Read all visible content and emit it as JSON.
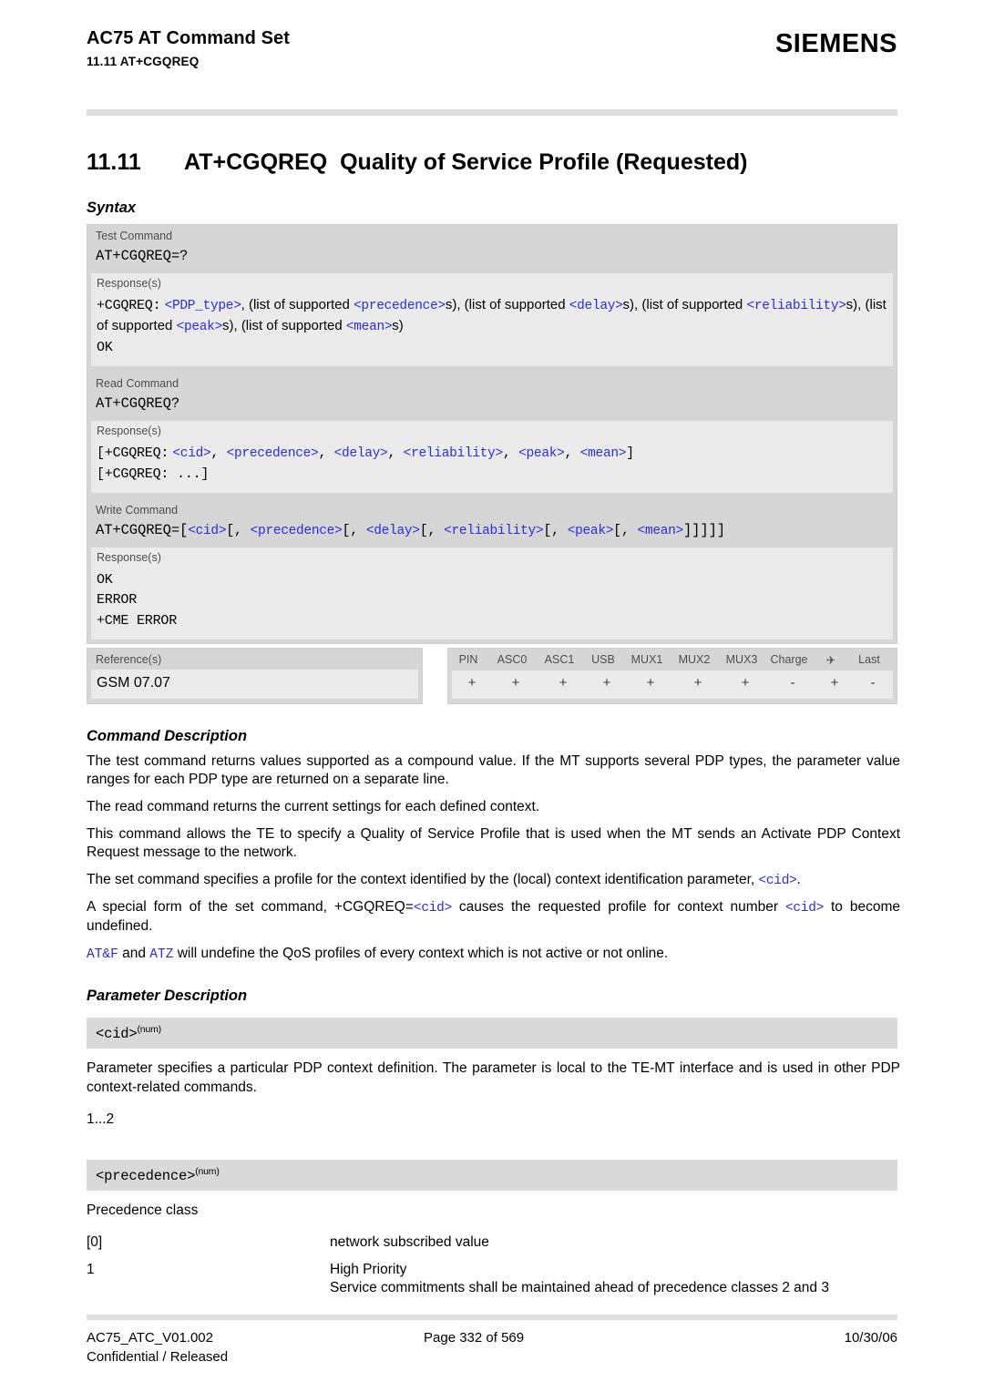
{
  "header": {
    "doc_title": "AC75 AT Command Set",
    "section_ref": "11.11 AT+CGQREQ",
    "brand": "SIEMENS"
  },
  "chapter": {
    "number": "11.11",
    "command": "AT+CGQREQ",
    "title": "Quality of Service Profile (Requested)"
  },
  "sections": {
    "syntax": "Syntax",
    "command_description": "Command Description",
    "parameter_description": "Parameter Description"
  },
  "syntax": {
    "test": {
      "label": "Test Command",
      "command": "AT+CGQREQ=?",
      "response_label": "Response(s)",
      "response_prefix": "+CGQREQ:",
      "response_parts": [
        {
          "t": "param",
          "v": "<PDP_type>"
        },
        {
          "t": "text",
          "v": ", (list of supported "
        },
        {
          "t": "param",
          "v": "<precedence>"
        },
        {
          "t": "text",
          "v": "s), (list of supported "
        },
        {
          "t": "param",
          "v": "<delay>"
        },
        {
          "t": "text",
          "v": "s), (list of supported "
        },
        {
          "t": "param",
          "v": "<reliability>"
        },
        {
          "t": "text",
          "v": "s), (list of supported "
        },
        {
          "t": "param",
          "v": "<peak>"
        },
        {
          "t": "text",
          "v": "s), (list of supported "
        },
        {
          "t": "param",
          "v": "<mean>"
        },
        {
          "t": "text",
          "v": "s)"
        }
      ],
      "ok": "OK"
    },
    "read": {
      "label": "Read Command",
      "command": "AT+CGQREQ?",
      "response_label": "Response(s)",
      "line1_prefix": "[+CGQREQ:",
      "line1_params": [
        "<cid>",
        "<precedence>",
        "<delay>",
        "<reliability>",
        "<peak>",
        "<mean>"
      ],
      "line1_suffix": "]",
      "line2": "[+CGQREQ: ...]"
    },
    "write": {
      "label": "Write Command",
      "command_prefix": "AT+CGQREQ=[",
      "command_params": [
        "<cid>",
        "<precedence>",
        "<delay>",
        "<reliability>",
        "<peak>",
        "<mean>"
      ],
      "command_suffix": "]]]]]",
      "response_label": "Response(s)",
      "responses": [
        "OK",
        "ERROR",
        "+CME ERROR"
      ]
    },
    "reference": {
      "label": "Reference(s)",
      "value": "GSM 07.07"
    }
  },
  "capability_matrix": {
    "columns": [
      "PIN",
      "ASC0",
      "ASC1",
      "USB",
      "MUX1",
      "MUX2",
      "MUX3",
      "Charge",
      "airplane-mode-icon",
      "Last"
    ],
    "airplane_glyph": "✈",
    "values": [
      "+",
      "+",
      "+",
      "+",
      "+",
      "+",
      "+",
      "-",
      "+",
      "-"
    ]
  },
  "command_description": {
    "paragraphs": [
      "The test command returns values supported as a compound value. If the MT supports several PDP types, the parameter value ranges for each PDP type are returned on a separate line.",
      "The read command returns the current settings for each defined context.",
      "This command allows the TE to specify a Quality of Service Profile that is used when the MT sends an Activate PDP Context Request message to the network."
    ],
    "set_command": {
      "before": "The set command specifies a profile for the context identified by the (local) context identification parameter, ",
      "param": "<cid>",
      "after": "."
    },
    "special_form": {
      "before": "A special form of the set command, +CGQREQ=",
      "param1": "<cid>",
      "middle": " causes the requested profile for context number ",
      "param2": "<cid>",
      "after": " to become undefined."
    },
    "reset": {
      "cmd1": "AT&F",
      "middle": " and ",
      "cmd2": "ATZ",
      "after": " will undefine the QoS profiles of every context which is not active or not online."
    }
  },
  "parameters": [
    {
      "name": "<cid>",
      "superscript": "(num)",
      "description": "Parameter specifies a particular PDP context definition. The parameter is local to the TE-MT interface and is used in other PDP context-related commands.",
      "range": "1...2"
    },
    {
      "name": "<precedence>",
      "superscript": "(num)",
      "description": "Precedence class",
      "values": [
        {
          "key": "[0]",
          "desc": "network subscribed value"
        },
        {
          "key": "1",
          "desc": "High Priority\nService commitments shall be maintained ahead of precedence classes 2 and 3"
        }
      ]
    }
  ],
  "footer": {
    "doc_id": "AC75_ATC_V01.002",
    "classification": "Confidential / Released",
    "page": "Page 332 of 569",
    "date": "10/30/06"
  },
  "colors": {
    "param_blue": "#2b2be0",
    "panel_dark": "#d6d6d6",
    "panel_light": "#ebebeb",
    "rule_gray": "#dedede"
  }
}
